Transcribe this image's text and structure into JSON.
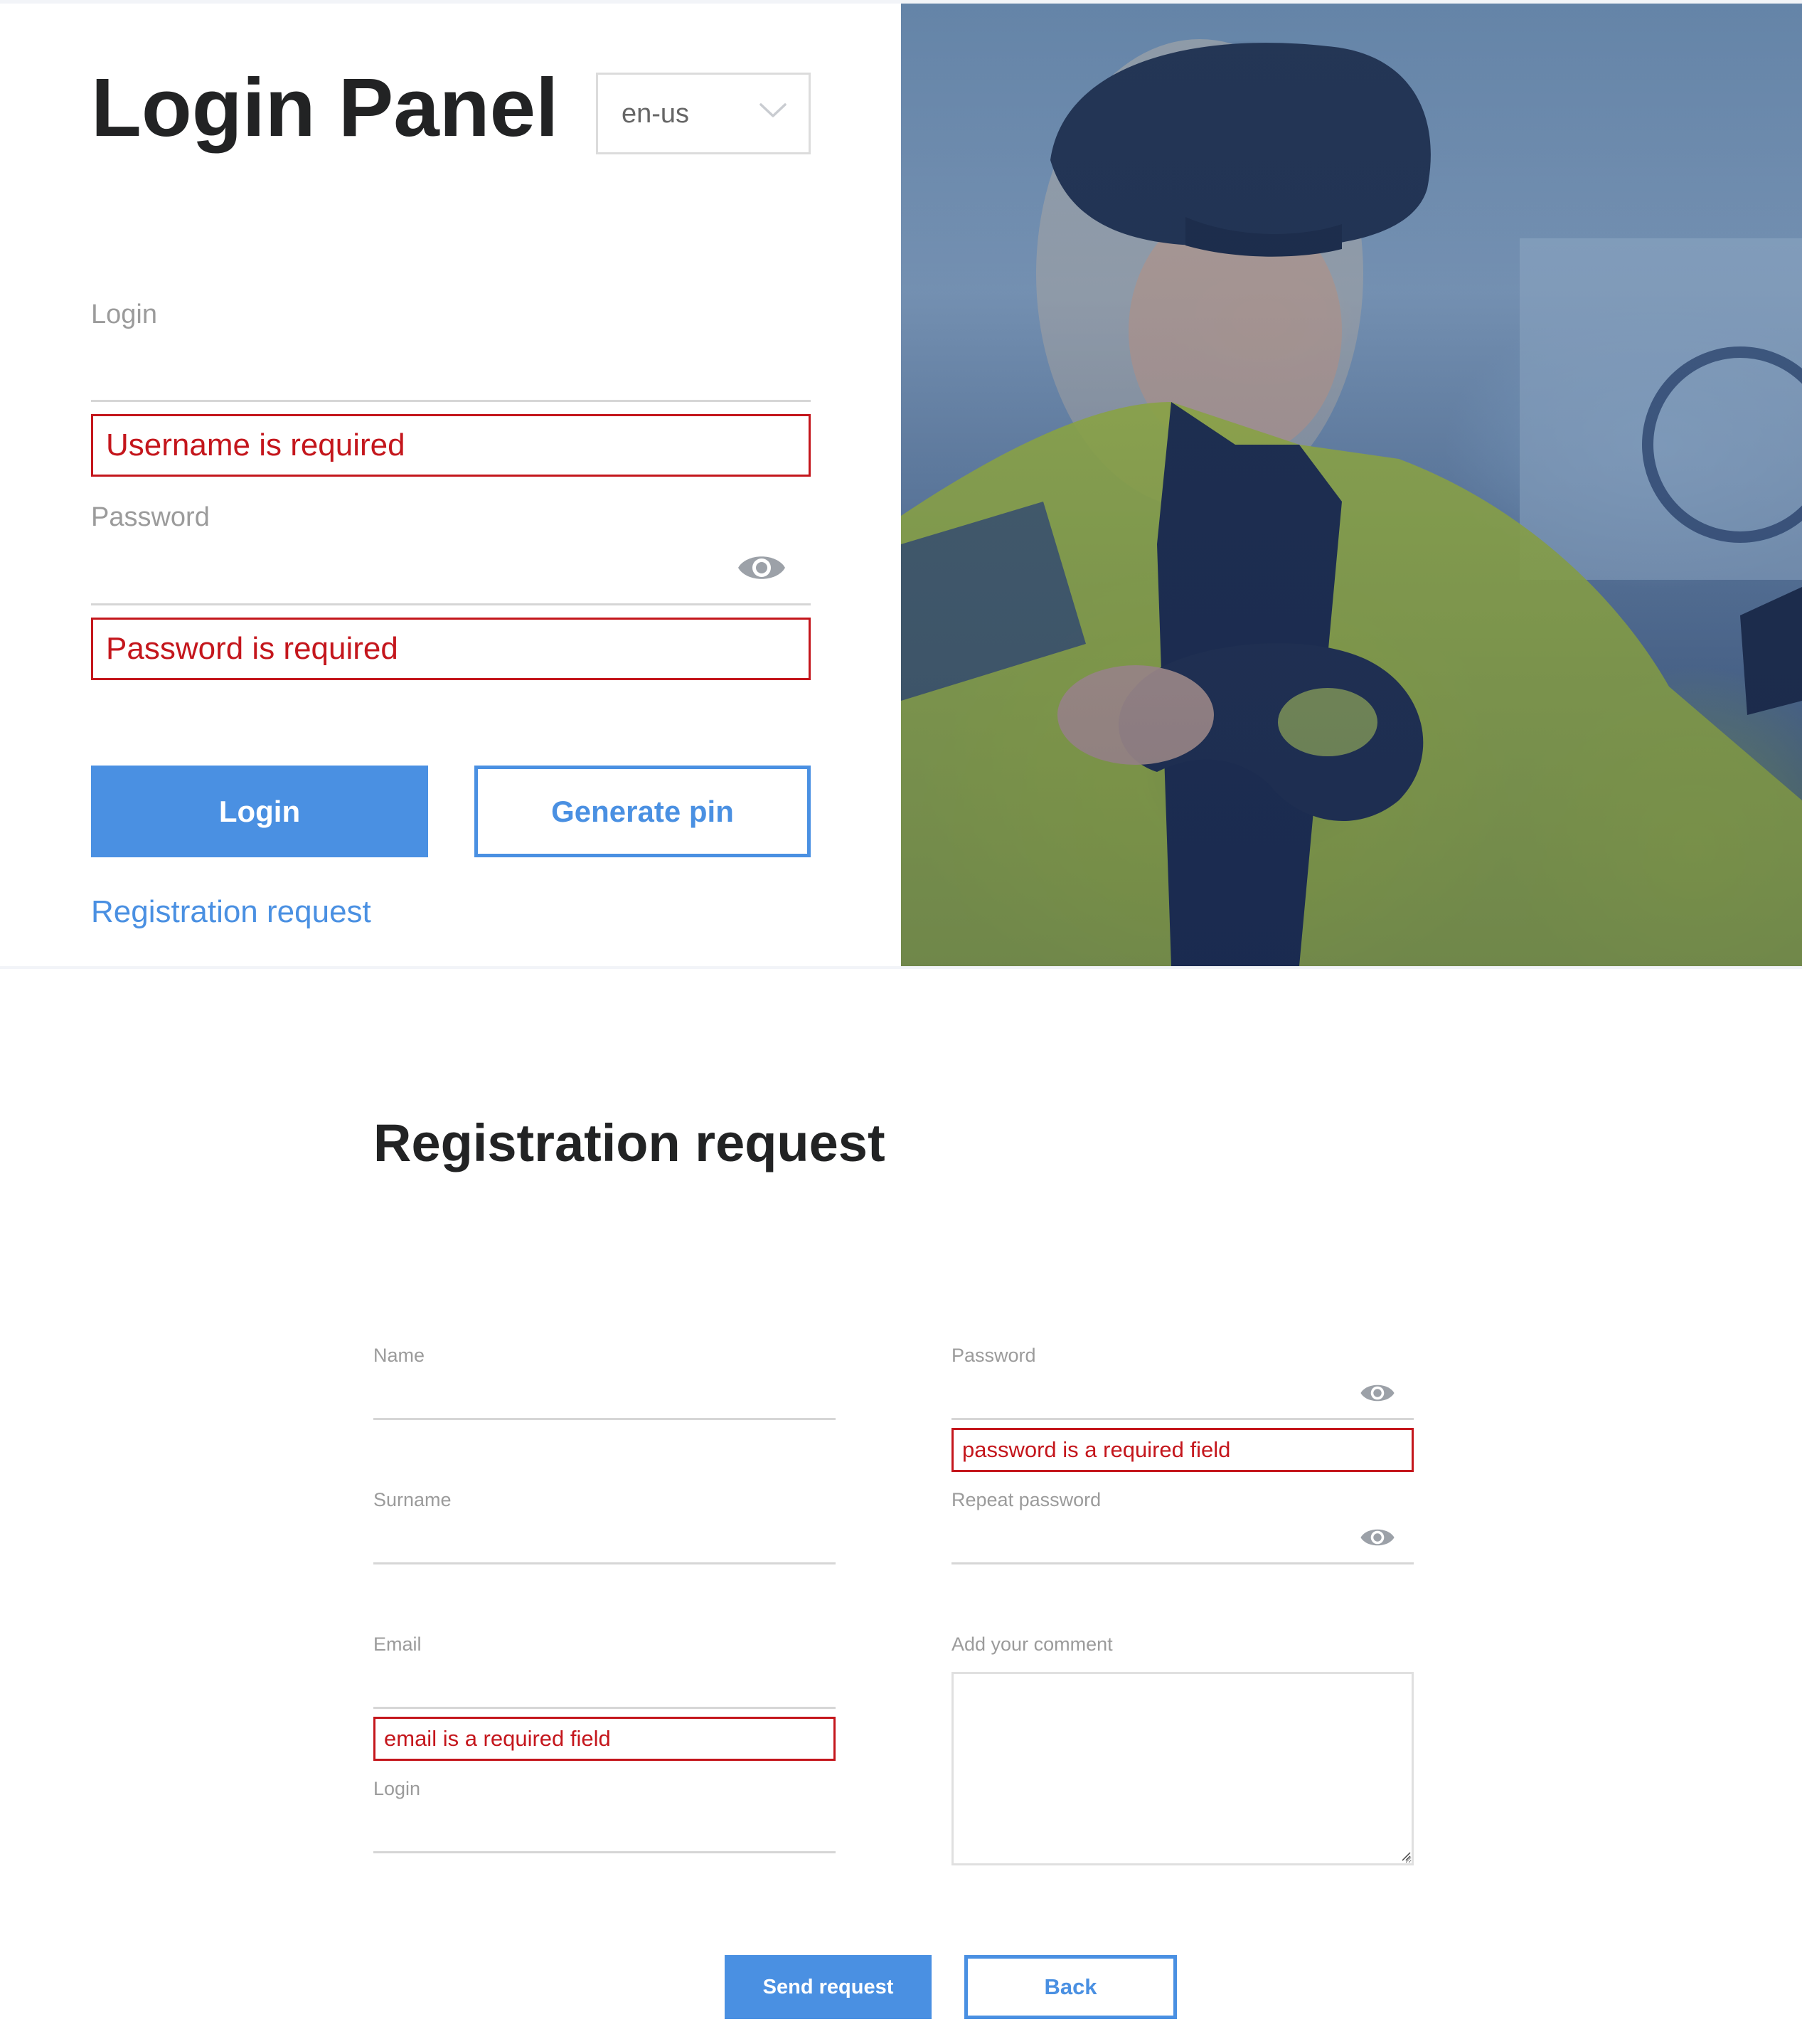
{
  "login_panel": {
    "title": "Login Panel",
    "language": {
      "selected": "en-us",
      "icon": "chevron-down-icon"
    },
    "fields": {
      "login": {
        "label": "Login",
        "value": "",
        "error": "Username is required"
      },
      "password": {
        "label": "Password",
        "value": "",
        "error": "Password is required",
        "toggle_icon": "eye-icon"
      }
    },
    "buttons": {
      "login": "Login",
      "generate_pin": "Generate pin"
    },
    "registration_link": "Registration request"
  },
  "hero_image": {
    "alt": "Woman in high-visibility jacket wearing VR headset holding VR controllers in a factory"
  },
  "registration": {
    "title": "Registration request",
    "left_column": {
      "name": {
        "label": "Name",
        "value": ""
      },
      "surname": {
        "label": "Surname",
        "value": ""
      },
      "email": {
        "label": "Email",
        "value": "",
        "error": "email is a required field"
      },
      "login": {
        "label": "Login",
        "value": ""
      }
    },
    "right_column": {
      "password": {
        "label": "Password",
        "value": "",
        "error": "password is a required field",
        "toggle_icon": "eye-icon"
      },
      "repeat_password": {
        "label": "Repeat password",
        "value": "",
        "toggle_icon": "eye-icon"
      },
      "comment": {
        "label": "Add your comment",
        "value": ""
      }
    },
    "buttons": {
      "send_request": "Send request",
      "back": "Back"
    }
  },
  "colors": {
    "accent_blue": "#4a90e2",
    "error_red": "#c4161c",
    "label_gray": "#9b9b9b",
    "heading": "#222324"
  }
}
